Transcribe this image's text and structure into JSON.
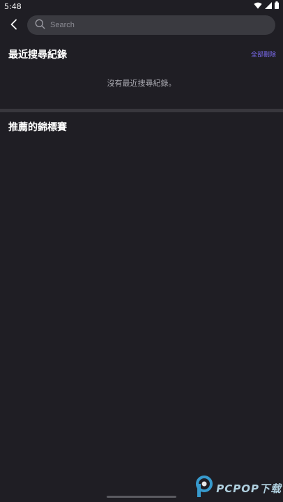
{
  "status_bar": {
    "time": "5:48",
    "icons": [
      "wifi-icon",
      "signal-icon",
      "battery-icon"
    ]
  },
  "top_bar": {
    "back_icon": "chevron-left-icon",
    "search_placeholder": "Search",
    "search_value": ""
  },
  "recent": {
    "title": "最近搜尋紀錄",
    "delete_all_label": "全部刪除",
    "empty_message": "沒有最近搜尋紀錄。"
  },
  "recommended": {
    "title": "推薦的錦標賽"
  },
  "watermark": {
    "text": "PCPOP下载"
  },
  "colors": {
    "background": "#1f1e24",
    "search_bg": "#3a3a40",
    "divider": "#38373d",
    "accent": "#7c6cf2",
    "muted_text": "#a9a9b0"
  }
}
